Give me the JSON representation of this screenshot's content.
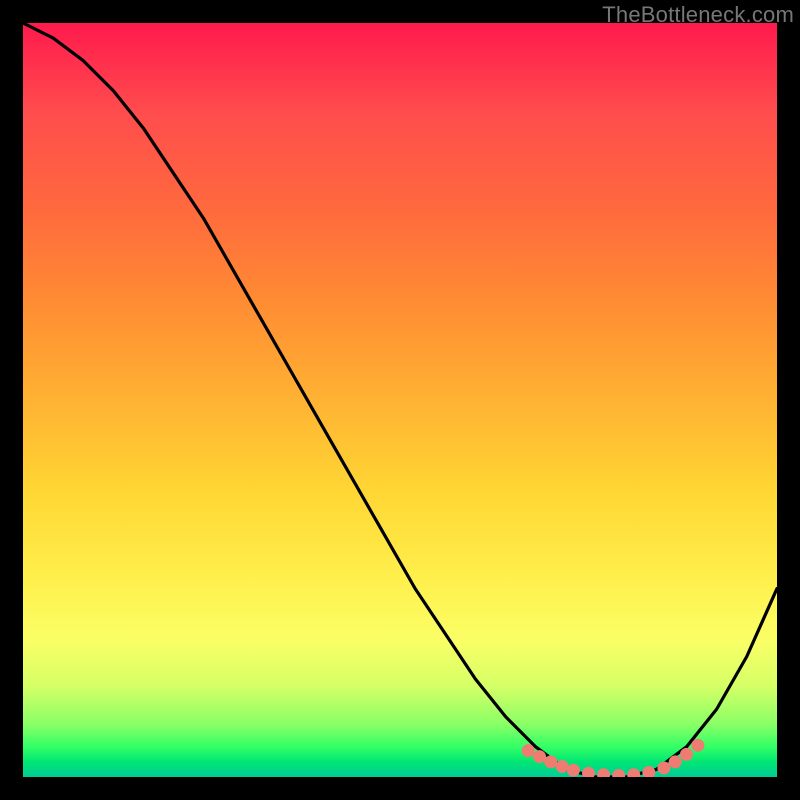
{
  "watermark": "TheBottleneck.com",
  "chart_data": {
    "type": "line",
    "title": "",
    "xlabel": "",
    "ylabel": "",
    "xlim": [
      0,
      100
    ],
    "ylim": [
      0,
      100
    ],
    "series": [
      {
        "name": "bottleneck-curve",
        "x": [
          0,
          4,
          8,
          12,
          16,
          20,
          24,
          28,
          32,
          36,
          40,
          44,
          48,
          52,
          56,
          60,
          64,
          68,
          72,
          76,
          80,
          84,
          88,
          92,
          96,
          100
        ],
        "y": [
          100,
          98,
          95,
          91,
          86,
          80,
          74,
          67,
          60,
          53,
          46,
          39,
          32,
          25,
          19,
          13,
          8,
          4,
          1,
          0,
          0,
          1,
          4,
          9,
          16,
          25
        ]
      }
    ],
    "markers": {
      "name": "highlight-dots",
      "color": "#ee7c73",
      "x": [
        67,
        68.5,
        70,
        71.5,
        73,
        75,
        77,
        79,
        81,
        83,
        85,
        86.5,
        88,
        89.5
      ],
      "y": [
        3.5,
        2.7,
        2.0,
        1.4,
        0.9,
        0.5,
        0.3,
        0.2,
        0.3,
        0.6,
        1.2,
        2.0,
        3.0,
        4.2
      ]
    },
    "gradient_colors": {
      "top": "#ff1a4d",
      "bottom": "#00cc99"
    }
  }
}
